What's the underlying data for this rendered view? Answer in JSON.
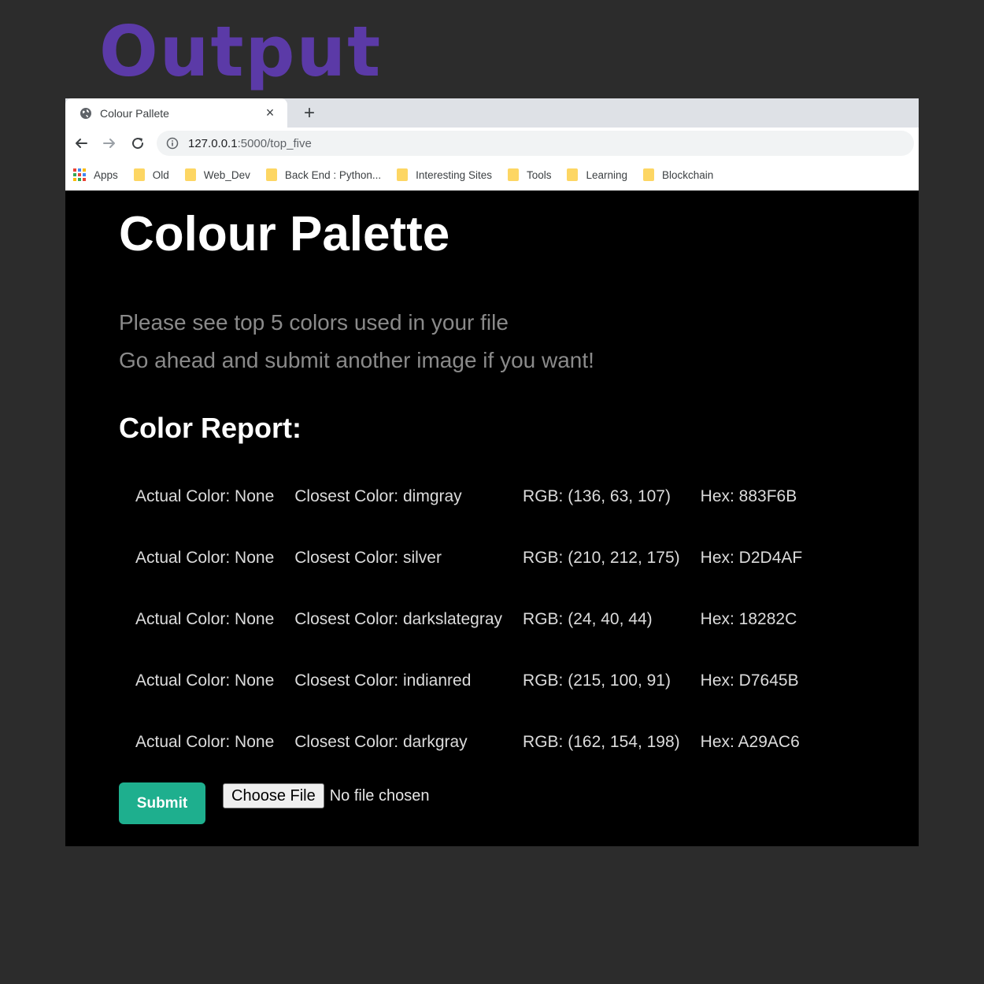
{
  "poster": {
    "title": "Output",
    "title_color": "#5b3aa7",
    "background": "#2c2c2c"
  },
  "browser": {
    "tab": {
      "title": "Colour Pallete",
      "favicon": "globe-icon",
      "close": "×"
    },
    "new_tab": "+",
    "url": {
      "host": "127.0.0.1",
      "path": ":5000/top_five"
    },
    "bookmarks": [
      {
        "label": "Apps",
        "icon": "apps-grid-icon"
      },
      {
        "label": "Old",
        "icon": "folder-icon"
      },
      {
        "label": "Web_Dev",
        "icon": "folder-icon"
      },
      {
        "label": "Back End : Python...",
        "icon": "folder-icon"
      },
      {
        "label": "Interesting Sites",
        "icon": "folder-icon"
      },
      {
        "label": "Tools",
        "icon": "folder-icon"
      },
      {
        "label": "Learning",
        "icon": "folder-icon"
      },
      {
        "label": "Blockchain",
        "icon": "folder-icon"
      }
    ]
  },
  "page": {
    "title": "Colour Palette",
    "lead_line_1": "Please see top 5 colors used in your file",
    "lead_line_2": "Go ahead and submit another image if you want!",
    "report_heading": "Color Report:",
    "rows": [
      {
        "actual": "Actual Color: None",
        "closest": "Closest Color: dimgray",
        "rgb": "RGB: (136, 63, 107)",
        "hex": "Hex: 883F6B"
      },
      {
        "actual": "Actual Color: None",
        "closest": "Closest Color: silver",
        "rgb": "RGB: (210, 212, 175)",
        "hex": "Hex: D2D4AF"
      },
      {
        "actual": "Actual Color: None",
        "closest": "Closest Color: darkslategray",
        "rgb": "RGB: (24, 40, 44)",
        "hex": "Hex: 18282C"
      },
      {
        "actual": "Actual Color: None",
        "closest": "Closest Color: indianred",
        "rgb": "RGB: (215, 100, 91)",
        "hex": "Hex: D7645B"
      },
      {
        "actual": "Actual Color: None",
        "closest": "Closest Color: darkgray",
        "rgb": "RGB: (162, 154, 198)",
        "hex": "Hex: A29AC6"
      }
    ],
    "submit_label": "Submit",
    "submit_color": "#1eaf8e",
    "choose_file_label": "Choose File",
    "no_file_text": "No file chosen"
  }
}
